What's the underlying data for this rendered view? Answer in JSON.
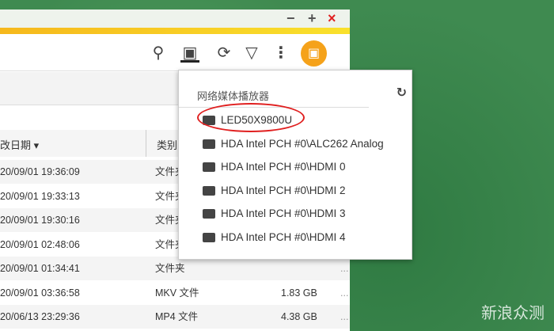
{
  "window": {
    "minimize": "−",
    "maximize": "+",
    "close": "×"
  },
  "toolbar": {
    "search_icon": "search-icon",
    "cast_icon": "cast-icon",
    "refresh_icon": "refresh-icon",
    "filter_icon": "filter-icon",
    "more_icon": "more-icon"
  },
  "table": {
    "headers": {
      "date": "改日期 ▾",
      "type": "类别"
    },
    "rows": [
      {
        "date": "20/09/01 19:36:09",
        "type": "文件夹",
        "size": ""
      },
      {
        "date": "20/09/01 19:33:13",
        "type": "文件夹",
        "size": ""
      },
      {
        "date": "20/09/01 19:30:16",
        "type": "文件夹",
        "size": ""
      },
      {
        "date": "20/09/01 02:48:06",
        "type": "文件夹",
        "size": ""
      },
      {
        "date": "20/09/01 01:34:41",
        "type": "文件夹",
        "size": "",
        "more": "..."
      },
      {
        "date": "20/09/01 03:36:58",
        "type": "MKV 文件",
        "size": "1.83 GB",
        "more": "..."
      },
      {
        "date": "20/06/13 23:29:36",
        "type": "MP4 文件",
        "size": "4.38 GB",
        "more": "..."
      }
    ]
  },
  "popup": {
    "title": "网络媒体播放器",
    "refresh": "↻",
    "items": [
      {
        "label": "LED50X9800U",
        "icon": "dlna-icon"
      },
      {
        "label": "HDA Intel PCH #0\\ALC262 Analog",
        "icon": "speaker-icon"
      },
      {
        "label": "HDA Intel PCH #0\\HDMI 0",
        "icon": "hdmi-audio-icon"
      },
      {
        "label": "HDA Intel PCH #0\\HDMI 2",
        "icon": "hdmi-audio-icon"
      },
      {
        "label": "HDA Intel PCH #0\\HDMI 3",
        "icon": "hdmi-audio-icon"
      },
      {
        "label": "HDA Intel PCH #0\\HDMI 4",
        "icon": "hdmi-audio-icon"
      }
    ]
  },
  "watermark": "新浪众测"
}
